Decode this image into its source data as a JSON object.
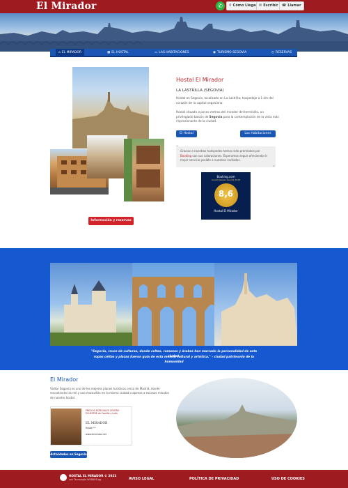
{
  "header": {
    "logo": "El Mirador",
    "buttons": [
      {
        "label": "Cómo Llegar",
        "icon": "map-pin-icon"
      },
      {
        "label": "Escribir",
        "icon": "mail-icon"
      },
      {
        "label": "Llamar",
        "icon": "phone-icon"
      }
    ]
  },
  "nav": {
    "items": [
      {
        "label": "EL MIRADOR",
        "icon": "home-icon"
      },
      {
        "label": "EL HOSTAL",
        "icon": "building-icon"
      },
      {
        "label": "LAS HABITACIONES",
        "icon": "bed-icon"
      },
      {
        "label": "TURISMO SEGOVIA",
        "icon": "camera-icon"
      },
      {
        "label": "RESERVAS",
        "icon": "clock-icon"
      }
    ]
  },
  "hostal": {
    "title": "Hostal El Mirador",
    "subtitle": "LA LASTRILLA (SEGOVIA)",
    "p1": "Hostal en Segovia, localizado en La Lastrilla, hospedaje a 1 km del corazón de la capital segoviana.",
    "p2_a": "Hostal situado a pocos metros del mirador del terminillo, un privilegiado balcón de ",
    "p2_b": "Segovia",
    "p2_c": " para la contemplación de la vista más impresionante de la ciudad.",
    "btn_hostal": "El Hostal",
    "btn_habitaciones": "Las Habitaciones",
    "quote_a": "Gracias a nuestros huéspedes hemos sido premiados por ",
    "quote_b": "Booking",
    "quote_c": " con sus valoraciones. Esperamos seguir ofreciendo el mejor servicio posible a nuestros invitados.",
    "award_brand": "Booking.com",
    "award_sub": "Guest Review Awards 2018",
    "award_score": "8,6",
    "award_name": "Hostal El Mirador",
    "reserve_btn": "Información y reservas"
  },
  "banner": {
    "quote1": "\"Segovia, cruce de culturas, donde celtas, romanos y árabes han marcado la personalidad de esta ciudad,",
    "quote2": "ropas celtas y plazas fueron guía de esta mezcla cultural y artística.\" - ciudad patrimonio de la humanidad"
  },
  "mirador": {
    "title": "El Mirador",
    "text": "Visitar Segovia es uno de los mejores planes turísticos cerca de Madrid, donde encontrarás las mil y una maravillas en la misma ciudad o apenas a escasos minutos de nuestro hostal.",
    "ad_top": "PRECIOS ESPECIALES CENTRO ECUESTRE de Castilla y León",
    "ad_name": "EL MIRADOR",
    "ad_sub": "Hostal **",
    "ad_web": "www.elmirador.net",
    "btn": "Actividades en Segovia"
  },
  "footer": {
    "copy": "HOSTAL EL MIRADOR © 2023",
    "credit": "con Tecnología WEBNEB.gg",
    "links": [
      "AVISO LEGAL",
      "POLÍTICA DE PRIVACIDAD",
      "USO DE COOKIES"
    ]
  },
  "colors": {
    "brand_red": "#9e1b20",
    "brand_blue": "#1558cf",
    "accent_red": "#d2232a"
  }
}
